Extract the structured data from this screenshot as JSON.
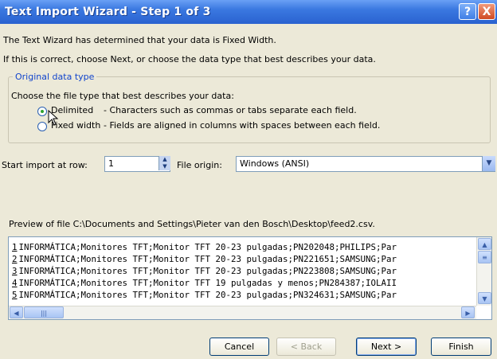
{
  "window": {
    "title": "Text Import Wizard - Step 1 of 3",
    "help_label": "?",
    "close_label": "X"
  },
  "intro": {
    "line1": "The Text Wizard has determined that your data is Fixed Width.",
    "line2": "If this is correct, choose Next, or choose the data type that best describes your data."
  },
  "data_type": {
    "group_label": "Original data type",
    "prompt": "Choose the file type that best describes your data:",
    "options": [
      {
        "label": "Delimited",
        "description": "- Characters such as commas or tabs separate each field.",
        "selected": true
      },
      {
        "label": "Fixed width",
        "description": "- Fields are aligned in columns with spaces between each field.",
        "selected": false
      }
    ]
  },
  "start_row": {
    "label": "Start import at row:",
    "value": "1"
  },
  "file_origin": {
    "label": "File origin:",
    "value": "Windows (ANSI)"
  },
  "preview": {
    "label": "Preview of file C:\\Documents and Settings\\Pieter van den Bosch\\Desktop\\feed2.csv.",
    "rows": [
      {
        "num": "1",
        "text": "INFORMÁTICA;Monitores TFT;Monitor TFT 20-23 pulgadas;PN202048;PHILIPS;Par"
      },
      {
        "num": "2",
        "text": "INFORMÁTICA;Monitores TFT;Monitor TFT 20-23 pulgadas;PN221651;SAMSUNG;Par"
      },
      {
        "num": "3",
        "text": "INFORMÁTICA;Monitores TFT;Monitor TFT 20-23 pulgadas;PN223808;SAMSUNG;Par"
      },
      {
        "num": "4",
        "text": "INFORMÁTICA;Monitores TFT;Monitor TFT 19 pulgadas y menos;PN284387;IOLAII"
      },
      {
        "num": "5",
        "text": "INFORMÁTICA;Monitores TFT;Monitor TFT 20-23 pulgadas;PN324631;SAMSUNG;Par"
      }
    ]
  },
  "buttons": {
    "cancel": "Cancel",
    "back": "< Back",
    "next": "Next >",
    "finish": "Finish"
  },
  "icons": {
    "help": "help-icon",
    "close": "close-icon",
    "spin": "spin-arrows-icon",
    "dropdown": "chevron-down-icon"
  },
  "colors": {
    "titlebar": "#2a62d0",
    "group_title": "#1144cc",
    "face": "#ece9d8"
  }
}
